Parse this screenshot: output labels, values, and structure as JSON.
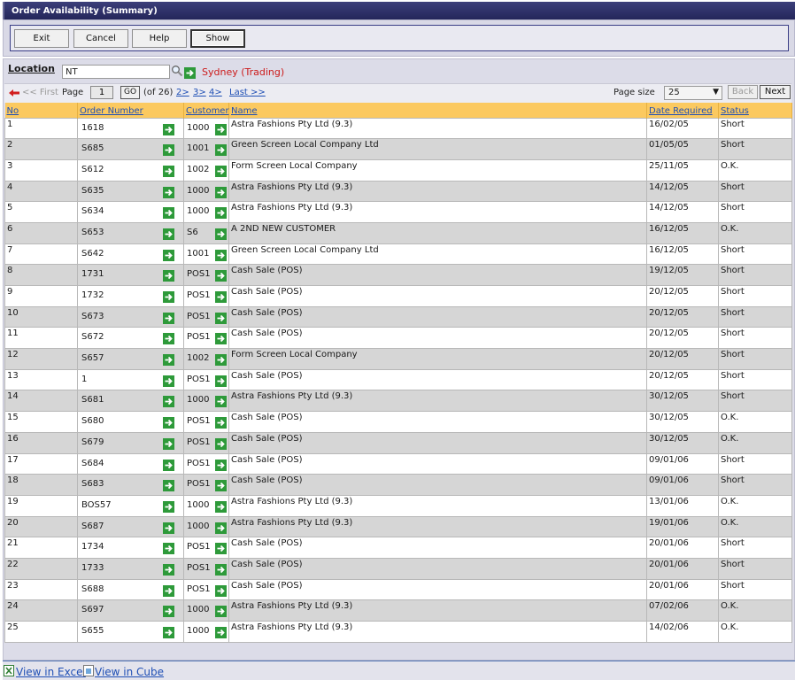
{
  "window": {
    "title": "Order Availability (Summary)"
  },
  "toolbar": {
    "exit": "Exit",
    "cancel": "Cancel",
    "help": "Help",
    "show": "Show"
  },
  "location": {
    "label": "Location",
    "code": "NT",
    "name": "Sydney (Trading)"
  },
  "pager": {
    "first": "<< First",
    "page_label": "Page",
    "page_value": "1",
    "go": "GO",
    "of": "(of 26)",
    "links": [
      "2>",
      "3>",
      "4>"
    ],
    "last": "Last >>",
    "page_size_label": "Page size",
    "page_size": "25",
    "back": "Back",
    "next": "Next"
  },
  "table": {
    "columns": {
      "no": "No",
      "order": "Order Number",
      "customer": "Customer",
      "name": "Name",
      "date": "Date Required",
      "status": "Status"
    },
    "rows": [
      {
        "no": "1",
        "order": "1618",
        "customer": "1000",
        "name": "Astra Fashions Pty Ltd (9.3)",
        "date": "16/02/05",
        "status": "Short"
      },
      {
        "no": "2",
        "order": "S685",
        "customer": "1001",
        "name": "Green Screen Local Company Ltd",
        "date": "01/05/05",
        "status": "Short"
      },
      {
        "no": "3",
        "order": "S612",
        "customer": "1002",
        "name": "Form Screen Local Company",
        "date": "25/11/05",
        "status": "O.K."
      },
      {
        "no": "4",
        "order": "S635",
        "customer": "1000",
        "name": "Astra Fashions Pty Ltd (9.3)",
        "date": "14/12/05",
        "status": "Short"
      },
      {
        "no": "5",
        "order": "S634",
        "customer": "1000",
        "name": "Astra Fashions Pty Ltd (9.3)",
        "date": "14/12/05",
        "status": "Short"
      },
      {
        "no": "6",
        "order": "S653",
        "customer": "S6",
        "name": "A 2ND NEW CUSTOMER",
        "date": "16/12/05",
        "status": "O.K."
      },
      {
        "no": "7",
        "order": "S642",
        "customer": "1001",
        "name": "Green Screen Local Company Ltd",
        "date": "16/12/05",
        "status": "Short"
      },
      {
        "no": "8",
        "order": "1731",
        "customer": "POS1",
        "name": "Cash Sale (POS)",
        "date": "19/12/05",
        "status": "Short"
      },
      {
        "no": "9",
        "order": "1732",
        "customer": "POS1",
        "name": "Cash Sale (POS)",
        "date": "20/12/05",
        "status": "Short"
      },
      {
        "no": "10",
        "order": "S673",
        "customer": "POS1",
        "name": "Cash Sale (POS)",
        "date": "20/12/05",
        "status": "Short"
      },
      {
        "no": "11",
        "order": "S672",
        "customer": "POS1",
        "name": "Cash Sale (POS)",
        "date": "20/12/05",
        "status": "Short"
      },
      {
        "no": "12",
        "order": "S657",
        "customer": "1002",
        "name": "Form Screen Local Company",
        "date": "20/12/05",
        "status": "Short"
      },
      {
        "no": "13",
        "order": "1",
        "customer": "POS1",
        "name": "Cash Sale (POS)",
        "date": "20/12/05",
        "status": "Short"
      },
      {
        "no": "14",
        "order": "S681",
        "customer": "1000",
        "name": "Astra Fashions Pty Ltd (9.3)",
        "date": "30/12/05",
        "status": "Short"
      },
      {
        "no": "15",
        "order": "S680",
        "customer": "POS1",
        "name": "Cash Sale (POS)",
        "date": "30/12/05",
        "status": "O.K."
      },
      {
        "no": "16",
        "order": "S679",
        "customer": "POS1",
        "name": "Cash Sale (POS)",
        "date": "30/12/05",
        "status": "O.K."
      },
      {
        "no": "17",
        "order": "S684",
        "customer": "POS1",
        "name": "Cash Sale (POS)",
        "date": "09/01/06",
        "status": "Short"
      },
      {
        "no": "18",
        "order": "S683",
        "customer": "POS1",
        "name": "Cash Sale (POS)",
        "date": "09/01/06",
        "status": "Short"
      },
      {
        "no": "19",
        "order": "BOS57",
        "customer": "1000",
        "name": "Astra Fashions Pty Ltd (9.3)",
        "date": "13/01/06",
        "status": "O.K."
      },
      {
        "no": "20",
        "order": "S687",
        "customer": "1000",
        "name": "Astra Fashions Pty Ltd (9.3)",
        "date": "19/01/06",
        "status": "O.K."
      },
      {
        "no": "21",
        "order": "1734",
        "customer": "POS1",
        "name": "Cash Sale (POS)",
        "date": "20/01/06",
        "status": "Short"
      },
      {
        "no": "22",
        "order": "1733",
        "customer": "POS1",
        "name": "Cash Sale (POS)",
        "date": "20/01/06",
        "status": "Short"
      },
      {
        "no": "23",
        "order": "S688",
        "customer": "POS1",
        "name": "Cash Sale (POS)",
        "date": "20/01/06",
        "status": "Short"
      },
      {
        "no": "24",
        "order": "S697",
        "customer": "1000",
        "name": "Astra Fashions Pty Ltd (9.3)",
        "date": "07/02/06",
        "status": "O.K."
      },
      {
        "no": "25",
        "order": "S655",
        "customer": "1000",
        "name": "Astra Fashions Pty Ltd (9.3)",
        "date": "14/02/06",
        "status": "O.K."
      }
    ]
  },
  "footer": {
    "excel": "View in Excel",
    "cube": "View in Cube"
  },
  "colors": {
    "header": "#fbc960",
    "row_alt": "#d6d6d6",
    "link": "#1f4fb5",
    "location_name": "#cc1a1a",
    "go_arrow": "#2e9a3a"
  },
  "icons": {
    "drill": "green-arrow-icon",
    "search": "magnifier-icon",
    "first": "first-page-icon",
    "excel": "excel-icon",
    "cube": "cube-icon"
  }
}
